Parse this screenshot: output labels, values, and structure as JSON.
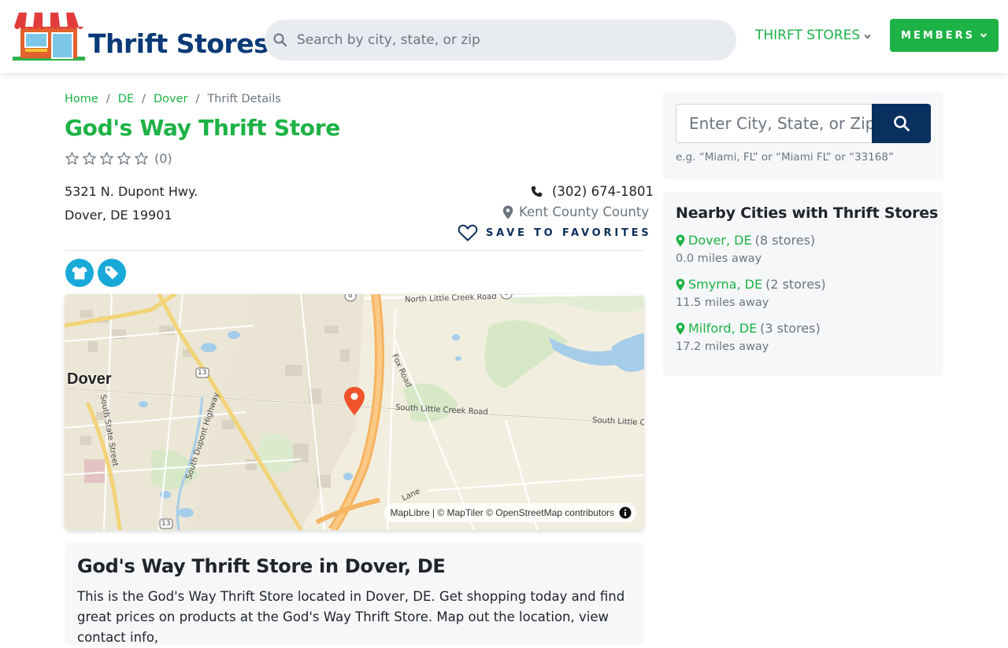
{
  "header": {
    "brand": "Thrift Stores",
    "search_placeholder": "Search by city, state, or zip",
    "nav_stores_label": "THIRFT STORES",
    "members_label": "MEMBERS",
    "accent_color": "#1db245",
    "brand_color": "#0a3a78"
  },
  "breadcrumb": {
    "items": [
      "Home",
      "DE",
      "Dover"
    ],
    "current": "Thrift Details",
    "separator": "/"
  },
  "store": {
    "name": "God's Way Thrift Store",
    "rating_count": "(0)",
    "rating_stars": 0,
    "address_line1": "5321 N. Dupont Hwy.",
    "address_line2": "Dover, DE 19901",
    "phone": "(302) 674-1801",
    "county": "Kent County County",
    "favorites_label": "SAVE TO FAVORITES",
    "category_icons": [
      "shirt-icon",
      "tag-icon"
    ]
  },
  "map": {
    "city_label": "Dover",
    "road_labels": {
      "north_little_creek": "North Little Creek Road",
      "south_little_creek": "South Little Creek Road",
      "south_little_creek_2": "South Little Cr",
      "fox_road": "Fox Road",
      "dupont": "South Dupont Highway",
      "south_state": "South State Street",
      "lane": "Lane",
      "route_13a": "13",
      "route_13b": "13",
      "route_8a": "8",
      "route_8b": "8"
    },
    "attribution": "MapLibre | © MapTiler © OpenStreetMap contributors"
  },
  "about": {
    "heading": "God's Way Thrift Store in Dover, DE",
    "text": "This is the God's Way Thrift Store located in Dover, DE. Get shopping today and find great prices on products at the God's Way Thrift Store. Map out the location, view contact info,"
  },
  "sidebar": {
    "search_placeholder": "Enter City, State, or Zip",
    "search_hint": "e.g. “Miami, FL” or “Miami FL” or “33168”",
    "nearby_heading": "Nearby Cities with Thrift Stores",
    "cities": [
      {
        "name": "Dover, DE",
        "count": "(8 stores)",
        "distance": "0.0 miles away"
      },
      {
        "name": "Smyrna, DE",
        "count": "(2 stores)",
        "distance": "11.5 miles away"
      },
      {
        "name": "Milford, DE",
        "count": "(3 stores)",
        "distance": "17.2 miles away"
      }
    ]
  }
}
